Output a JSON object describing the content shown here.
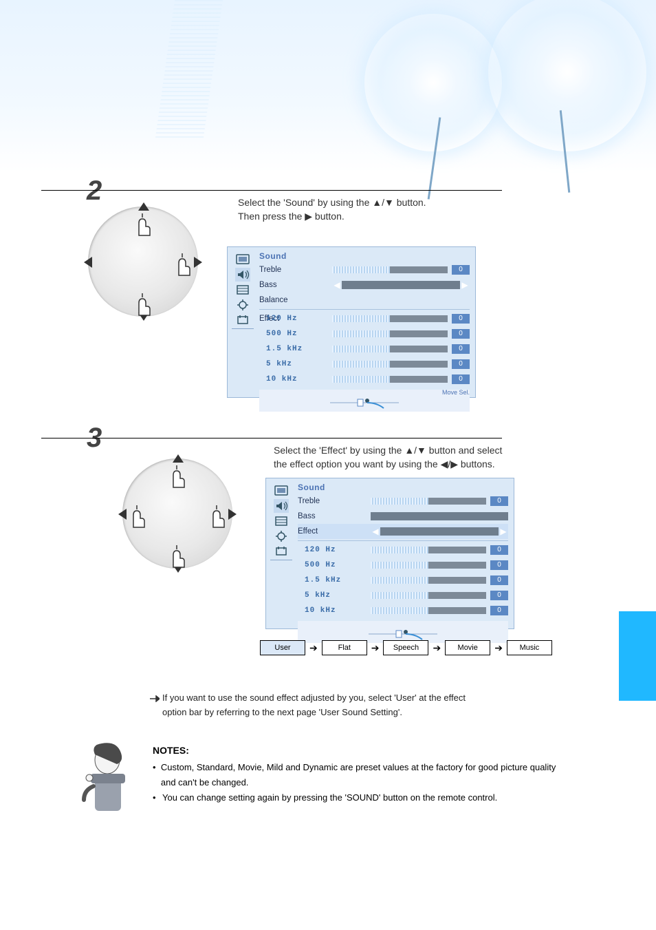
{
  "step2": {
    "text_line1": "Select the 'Sound' by using the ▲/▼ button.",
    "text_line2": "Then press the ▶ button.",
    "osd": {
      "title": "Sound",
      "rows": {
        "treble": "Treble",
        "bass": "Bass",
        "balance": "Balance",
        "effect": "Effect"
      },
      "eq": [
        {
          "label": "120 Hz",
          "val": "0"
        },
        {
          "label": "500 Hz",
          "val": "0"
        },
        {
          "label": "1.5 kHz",
          "val": "0"
        },
        {
          "label": "5   kHz",
          "val": "0"
        },
        {
          "label": "10  kHz",
          "val": "0"
        }
      ],
      "treble_val": "0",
      "movehint": "Move   Sel."
    }
  },
  "step3": {
    "text_line1": "Select the 'Effect' by using the ▲/▼ button and select",
    "text_line2": "the effect option you want by using the ◀/▶ buttons.",
    "osd": {
      "title": "Sound"
    },
    "flow": [
      "User",
      "Flat",
      "Speech",
      "Movie",
      "Music"
    ]
  },
  "bottom_para": {
    "line1": "If you want to use the sound effect adjusted by you, select 'User' at the effect",
    "line2": "option bar by referring to the next page 'User Sound Setting'."
  },
  "notes": {
    "title": "NOTES:",
    "items": [
      "Custom, Standard, Movie, Mild and Dynamic are preset values at the factory for good picture quality and can't be changed.",
      "You can change setting again by pressing the 'SOUND' button on the remote control."
    ]
  }
}
